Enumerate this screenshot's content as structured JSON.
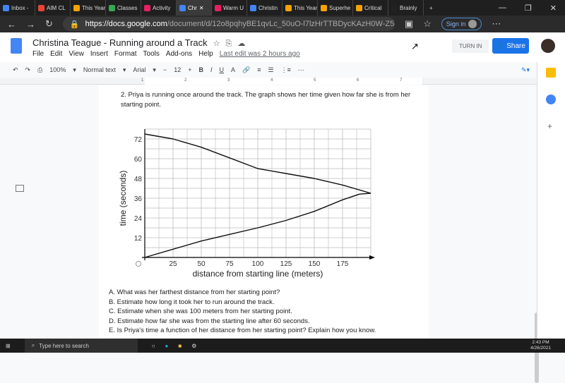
{
  "browser": {
    "tabs": [
      "Inbox - ",
      "AIM CL",
      "This Year",
      "Classes",
      "Activity",
      "Chr",
      "Warm U",
      "Christin",
      "This Year",
      "Superhe",
      "Critical",
      "Brainly"
    ],
    "active_tab": 5,
    "url_host": "https://docs.google.com",
    "url_path": "/document/d/12o8pqhyBE1qvLc_50uO-l7lzHrTTBDycKAzH0W-Z5nk/e...",
    "sign_in": "Sign in"
  },
  "doc": {
    "title": "Christina Teague - Running around a Track",
    "menu": [
      "File",
      "Edit",
      "View",
      "Insert",
      "Format",
      "Tools",
      "Add-ons",
      "Help"
    ],
    "last_edit": "Last edit was 2 hours ago",
    "turn_in": "TURN IN",
    "share": "Share"
  },
  "toolbar": {
    "zoom": "100%",
    "style": "Normal text",
    "font": "Arial",
    "size": "12"
  },
  "ruler": [
    "1",
    "2",
    "3",
    "4",
    "5",
    "6",
    "7"
  ],
  "content": {
    "question": "2. Priya is running once around the track. The graph shows her time given how far she is from her starting point.",
    "items": [
      "A.  What was her farthest distance from her starting point?",
      "B.  Estimate how long it took her to run around the track.",
      "C.  Estimate when she was 100 meters from her starting point.",
      "D.  Estimate how far she was from the starting line after 60 seconds.",
      "E.  Is Priya's time a function of her distance from her starting point? Explain how you know."
    ]
  },
  "chart_data": {
    "type": "line",
    "xlabel": "distance from starting line (meters)",
    "ylabel": "time (seconds)",
    "xlim": [
      0,
      200
    ],
    "ylim": [
      0,
      78
    ],
    "xticks": [
      25,
      50,
      75,
      100,
      125,
      150,
      175
    ],
    "yticks": [
      12,
      24,
      36,
      48,
      60,
      72
    ],
    "grid": true,
    "series": [
      {
        "x": [
          0,
          25,
          50,
          75,
          100,
          125,
          150,
          175,
          200
        ],
        "y": [
          75,
          72,
          67,
          60.5,
          54,
          51,
          48,
          44,
          39
        ]
      },
      {
        "x": [
          0,
          25,
          50,
          75,
          100,
          125,
          150,
          175,
          190,
          200
        ],
        "y": [
          0,
          5,
          10,
          14,
          18,
          22.5,
          28,
          35,
          38.5,
          39
        ]
      }
    ]
  },
  "taskbar": {
    "search": "Type here to search",
    "time": "2:43 PM",
    "date": "4/26/2021"
  }
}
